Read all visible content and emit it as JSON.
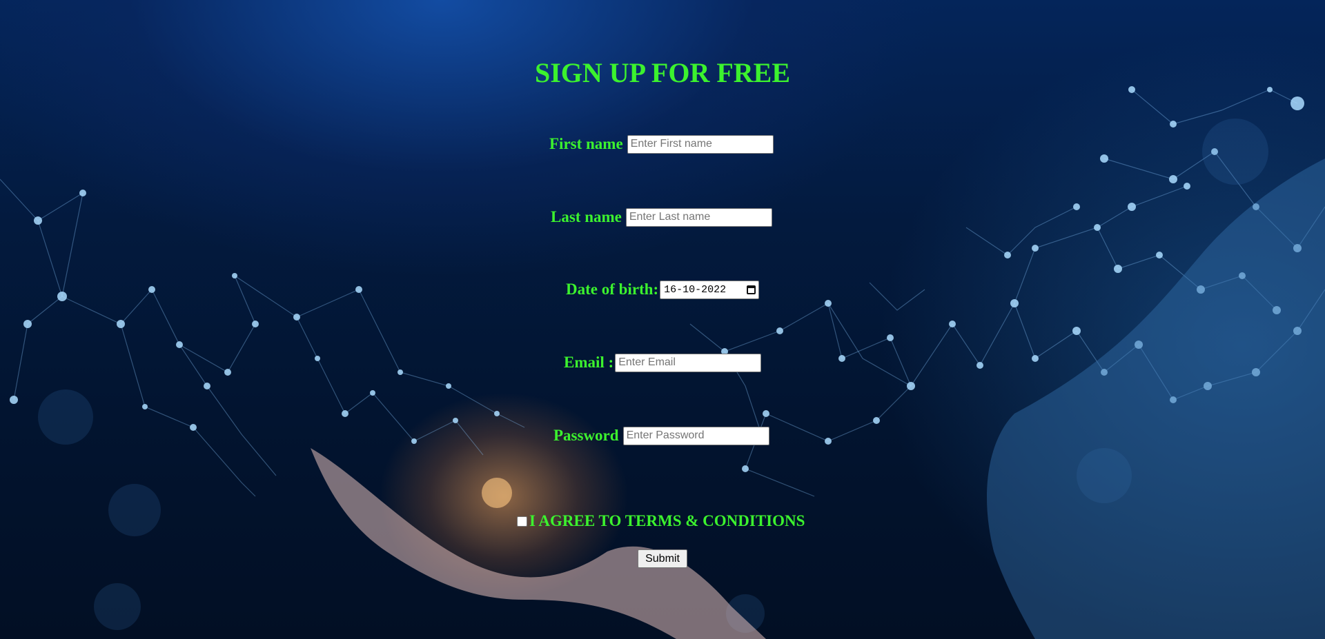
{
  "page": {
    "title": "SIGN UP FOR FREE"
  },
  "form": {
    "first_name": {
      "label": "First name",
      "placeholder": "Enter First name"
    },
    "last_name": {
      "label": "Last name",
      "placeholder": "Enter Last name"
    },
    "dob": {
      "label": "Date of birth:",
      "value": "16-10-2022"
    },
    "email": {
      "label": "Email :",
      "placeholder": "Enter Email"
    },
    "password": {
      "label": "Password",
      "placeholder": "Enter Password"
    },
    "terms": {
      "label": "I AGREE TO TERMS & CONDITIONS",
      "checked": false
    },
    "submit_label": "Submit"
  },
  "icons": {
    "calendar": "calendar-icon"
  },
  "colors": {
    "accent": "#3cf22e",
    "background": "#031a3e"
  }
}
